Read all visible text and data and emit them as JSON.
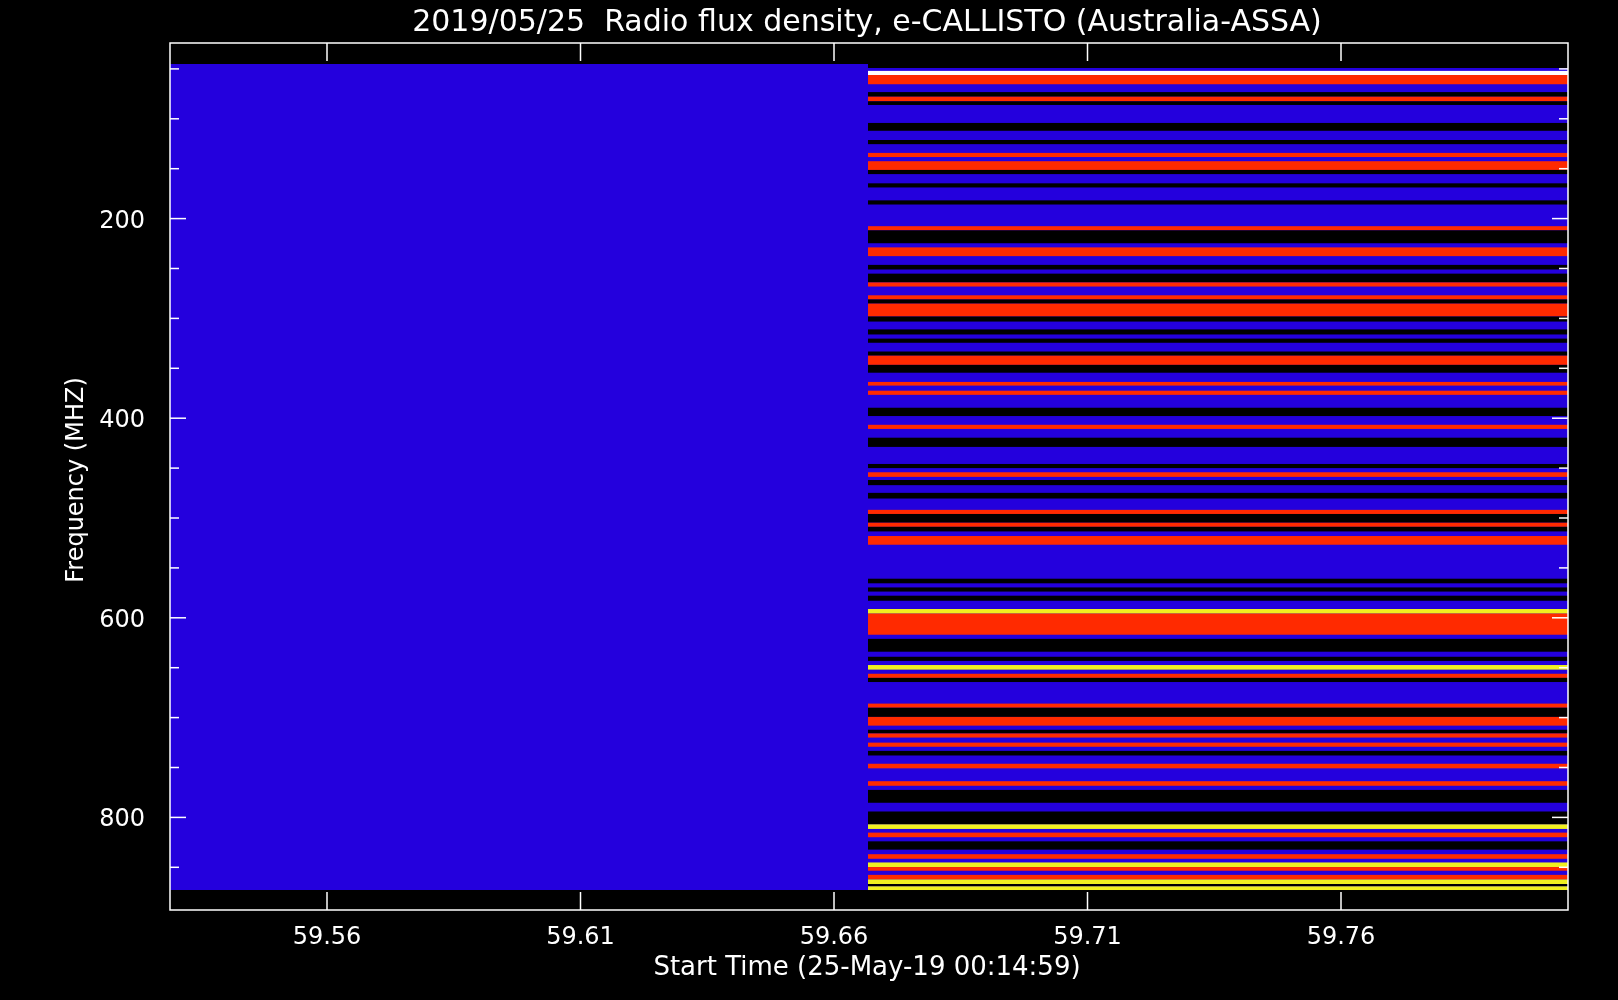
{
  "title": "2019/05/25  Radio flux density, e-CALLISTO (Australia-ASSA)",
  "y_axis": {
    "label": "Frequency (MHZ)",
    "ticks": [
      "200",
      "400",
      "600",
      "800"
    ]
  },
  "x_axis": {
    "label": "Start Time (25-May-19 00:14:59)",
    "ticks": [
      "59.56",
      "59.61",
      "59.66",
      "59.71",
      "59.76"
    ]
  }
}
